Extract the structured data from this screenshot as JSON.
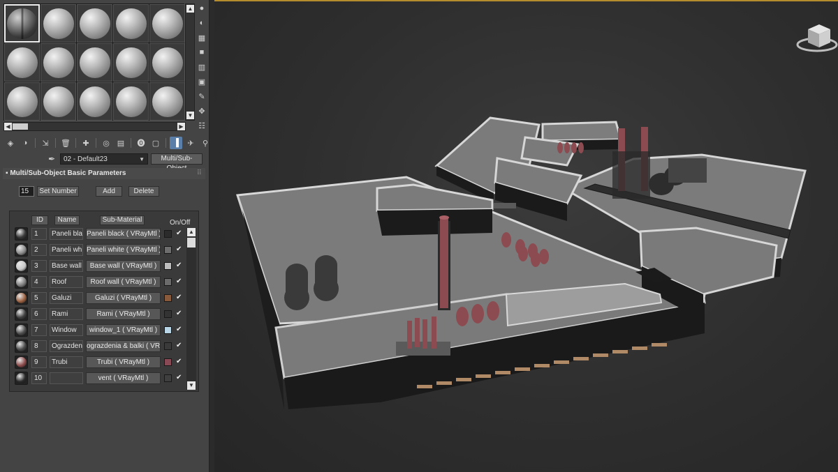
{
  "material_slots": {
    "count": 15,
    "active_index": 0
  },
  "material": {
    "name": "02 - Default23",
    "type": "Multi/Sub-Object"
  },
  "rollout": {
    "title": "Multi/Sub-Object Basic Parameters"
  },
  "params": {
    "number_value": "15",
    "set_number_label": "Set Number",
    "add_label": "Add",
    "delete_label": "Delete"
  },
  "table": {
    "headers": {
      "id": "ID",
      "name": "Name",
      "sub": "Sub-Material",
      "onoff": "On/Off"
    },
    "rows": [
      {
        "id": "1",
        "name": "Paneli black",
        "sub": "Paneli black  ( VRayMtl )",
        "color": "#2b2b2b",
        "sphere": "#3a3a3a",
        "on": "✔"
      },
      {
        "id": "2",
        "name": "Paneli white",
        "sub": "Paneli white  ( VRayMtl )",
        "color": "#6e6e6e",
        "sphere": "#8a8a8a",
        "on": "✔"
      },
      {
        "id": "3",
        "name": "Base wall",
        "sub": "Base wall  ( VRayMtl )",
        "color": "#bdbdbd",
        "sphere": "#c8c8c8",
        "on": "✔"
      },
      {
        "id": "4",
        "name": "Roof",
        "sub": "Roof wall  ( VRayMtl )",
        "color": "#6b6b6b",
        "sphere": "#7c7c7c",
        "on": "✔"
      },
      {
        "id": "5",
        "name": "Galuzi",
        "sub": "Galuzi  ( VRayMtl )",
        "color": "#8a5a3c",
        "sphere": "#9a6040",
        "on": "✔"
      },
      {
        "id": "6",
        "name": "Rami",
        "sub": "Rami  ( VRayMtl )",
        "color": "#333333",
        "sphere": "#404040",
        "on": "✔"
      },
      {
        "id": "7",
        "name": "Window",
        "sub": "window_1  ( VRayMtl )",
        "color": "#b9d6e6",
        "sphere": "#4e4e4e",
        "on": "✔"
      },
      {
        "id": "8",
        "name": "Ograzdenia",
        "sub": "ograzdenia & balki  ( VRayMtl )",
        "color": "#3a3a3a",
        "sphere": "#4a4a4a",
        "on": "✔"
      },
      {
        "id": "9",
        "name": "Trubi",
        "sub": "Trubi  ( VRayMtl )",
        "color": "#8a4a55",
        "sphere": "#8c4b4b",
        "on": "✔"
      },
      {
        "id": "10",
        "name": "",
        "sub": "vent  ( VRayMtl )",
        "color": "#3f3f3f",
        "sphere": "#2a2a2a",
        "on": "✔"
      }
    ]
  },
  "colors": {
    "viewport_border": "#b58d2d",
    "roof": "#7b7b7b",
    "chimney": "#8c4b50"
  }
}
